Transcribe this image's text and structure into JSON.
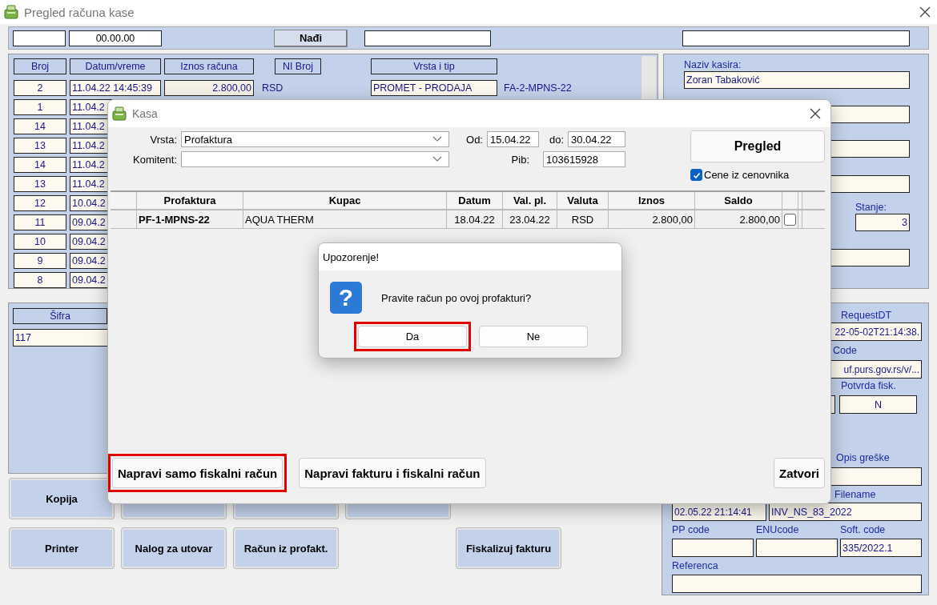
{
  "window": {
    "title": "Pregled računa kase"
  },
  "toolbar": {
    "date_field": "00.00.00",
    "find_button": "Nađi"
  },
  "receipts": {
    "columns": [
      "Broj",
      "Datum/vreme",
      "Iznos računa",
      "NI Broj",
      "Vrsta i tip"
    ],
    "rows": [
      {
        "broj": "2",
        "datum": "11.04.22 14:45:39",
        "iznos": "2.800,00",
        "valuta": "RSD",
        "vrsta": "PROMET - PRODAJA",
        "oznaka": "FA-2-MPNS-22"
      },
      {
        "broj": "1",
        "datum": "11.04.2"
      },
      {
        "broj": "14",
        "datum": "11.04.2"
      },
      {
        "broj": "13",
        "datum": "11.04.2"
      },
      {
        "broj": "14",
        "datum": "11.04.2"
      },
      {
        "broj": "13",
        "datum": "11.04.2"
      },
      {
        "broj": "12",
        "datum": "10.04.2"
      },
      {
        "broj": "11",
        "datum": "09.04.2"
      },
      {
        "broj": "10",
        "datum": "09.04.2"
      },
      {
        "broj": "9",
        "datum": "09.04.2"
      },
      {
        "broj": "8",
        "datum": "09.04.2"
      }
    ]
  },
  "cashier": {
    "label": "Naziv kasira:",
    "value": "Zoran Tabaković",
    "stanje_label": "Stanje:",
    "stanje": "3"
  },
  "items": {
    "column": "Šifra",
    "value": "117"
  },
  "fiscal": {
    "request_dt_label": "RequestDT",
    "request_dt": "22-05-02T21:14:38.",
    "code_label": "Code",
    "code": "uf.purs.gov.rs/v/...",
    "potvrda_label": "Potvrda fisk.",
    "potvrda": "N",
    "opis_label": "Opis greške",
    "filename_label": "Filename",
    "datetime": "02.05.22 21:14:41",
    "filename": "INV_NS_83_2022",
    "pp_label": "PP code",
    "enu_label": "ENUcode",
    "soft_label": "Soft. code",
    "soft_code": "335/2022.1",
    "referenca_label": "Referenca"
  },
  "buttons_row1": [
    "Kopija"
  ],
  "buttons_row2": [
    "Printer",
    "Nalog za utovar",
    "Račun iz profakt.",
    "Fiskalizuj fakturu"
  ],
  "kasa_dialog": {
    "title": "Kasa",
    "vrsta_label": "Vrsta:",
    "vrsta": "Profaktura",
    "komitent_label": "Komitent:",
    "od_label": "Od:",
    "od": "15.04.22",
    "do_label": "do:",
    "do": "30.04.22",
    "pib_label": "Pib:",
    "pib": "103615928",
    "pregled_button": "Pregled",
    "price_list": {
      "label": "Cene iz cenovnika",
      "checked": true
    },
    "table": {
      "columns": [
        "Profaktura",
        "Kupac",
        "Datum",
        "Val. pl.",
        "Valuta",
        "Iznos",
        "Saldo"
      ],
      "rows": [
        {
          "cells": [
            "PF-1-MPNS-22",
            "AQUA THERM",
            "18.04.22",
            "23.04.22",
            "RSD",
            "2.800,00",
            "2.800,00"
          ],
          "checked": false
        }
      ]
    },
    "actions": [
      {
        "label": "Napravi samo fiskalni račun",
        "highlighted": true
      },
      {
        "label": "Napravi fakturu i fiskalni račun",
        "highlighted": false
      },
      {
        "label": "Zatvori",
        "highlighted": false
      }
    ]
  },
  "alert": {
    "title": "Upozorenje!",
    "icon": "?",
    "message": "Pravite račun po ovoj profakturi?",
    "buttons": [
      {
        "label": "Da",
        "highlighted": true
      },
      {
        "label": "Ne",
        "highlighted": false
      }
    ]
  }
}
